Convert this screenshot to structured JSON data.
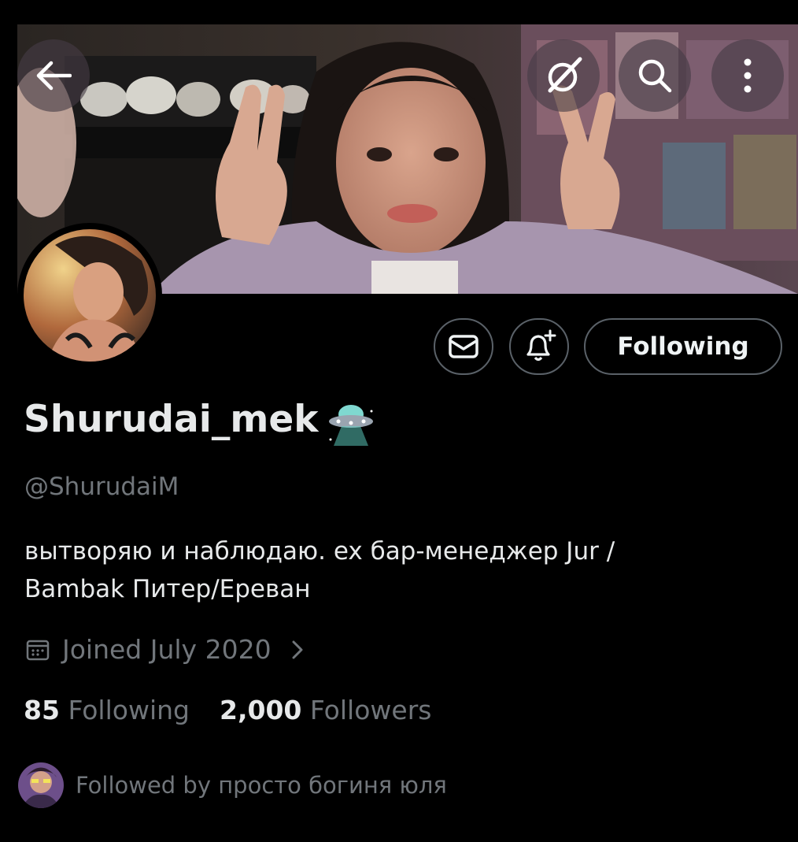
{
  "header": {
    "back_icon": "arrow-left-icon",
    "grok_icon": "slash-circle-icon",
    "search_icon": "search-icon",
    "more_icon": "more-vertical-icon"
  },
  "profile": {
    "display_name": "Shurudai_mek",
    "name_emoji": "ufo-emoji",
    "handle": "@ShurudaiM",
    "bio_line1": "вытворяю и наблюдаю. ex бар-менеджер Jur /",
    "bio_line2": "Bambak  Питер/Ереван",
    "joined": "Joined July 2020",
    "following_count": "85",
    "following_label": "Following",
    "followers_count": "2,000",
    "followers_label": "Followers",
    "followed_by": "Followed by просто богиня юля"
  },
  "actions": {
    "message_icon": "envelope-icon",
    "notify_icon": "bell-plus-icon",
    "following_button": "Following"
  },
  "colors": {
    "background": "#000000",
    "primary_text": "#e7e9ea",
    "secondary_text": "#71767b",
    "border": "#5a6168"
  }
}
